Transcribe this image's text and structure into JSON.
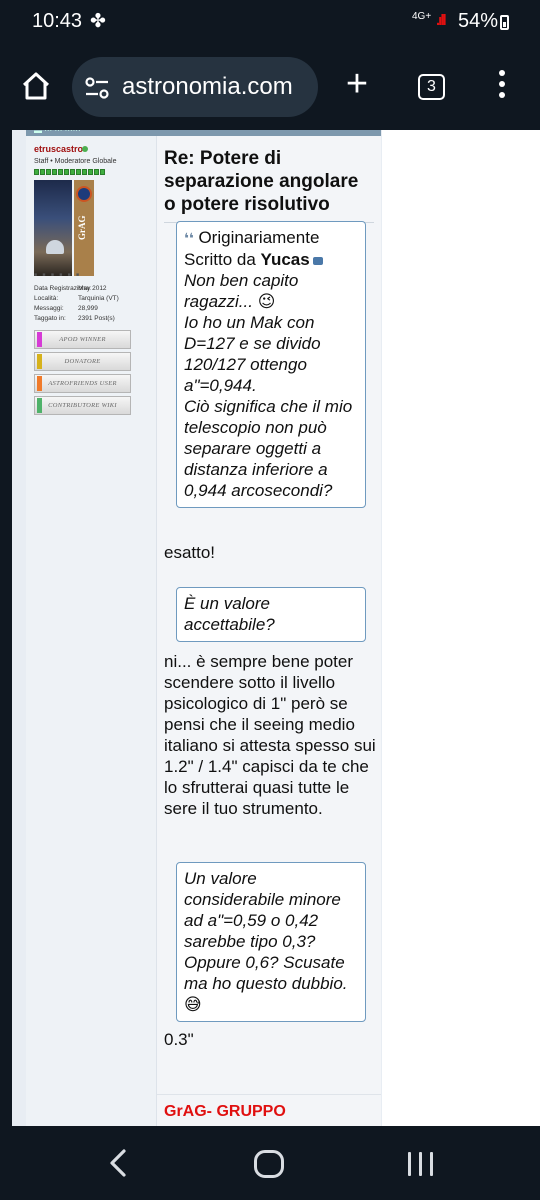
{
  "status": {
    "time": "10:43",
    "network": "4G+",
    "battery": "54%"
  },
  "browser": {
    "url": "astronomia.com",
    "tab_count": "3"
  },
  "user": {
    "name": "etruscastro",
    "role": "Staff • Moderatore Globale",
    "avatar_text": "GrAG",
    "info": [
      {
        "k": "Data Registrazione:",
        "v": "May 2012"
      },
      {
        "k": "Località:",
        "v": "Tarquinia (VT)"
      },
      {
        "k": "Messaggi:",
        "v": "28,999"
      },
      {
        "k": "Taggato in:",
        "v": "2391 Post(s)"
      }
    ],
    "badges": [
      {
        "label": "APOD WINNER",
        "color": "#d63bd6"
      },
      {
        "label": "DONATORE",
        "color": "#d6b21c"
      },
      {
        "label": "ASTROFRIENDS USER",
        "color": "#f07a2a"
      },
      {
        "label": "CONTRIBUTORE WIKI",
        "color": "#4fb26a"
      }
    ]
  },
  "post": {
    "title": "Re: Potere di separazione angolare o potere risolutivo",
    "quote1": {
      "prefix": "Originariamente Scritto da",
      "author": "Yucas",
      "lines": [
        "Non ben capito ragazzi... 😉",
        "Io ho un Mak con D=127 e se divido 120/127 ottengo a\"=0,944.",
        "Ciò significa che il mio telescopio non può separare oggetti a distanza inferiore a 0,944 arcosecondi?"
      ]
    },
    "reply1": "esatto!",
    "quote2": "È un valore accettabile?",
    "reply2": "ni... è sempre bene poter scendere sotto il livello psicologico di 1\" però se pensi che il seeing medio italiano si attesta spesso sui 1.2\" / 1.4\" capisci da te che lo sfrutterai quasi tutte le sere il tuo strumento.",
    "quote3": "Un valore considerabile minore ad a\"=0,59 o 0,42 sarebbe tipo 0,3? Oppure 0,6? Scusate ma ho questo dubbio. 😅",
    "reply3": "0.3\"",
    "signature": "GrAG- GRUPPO"
  }
}
